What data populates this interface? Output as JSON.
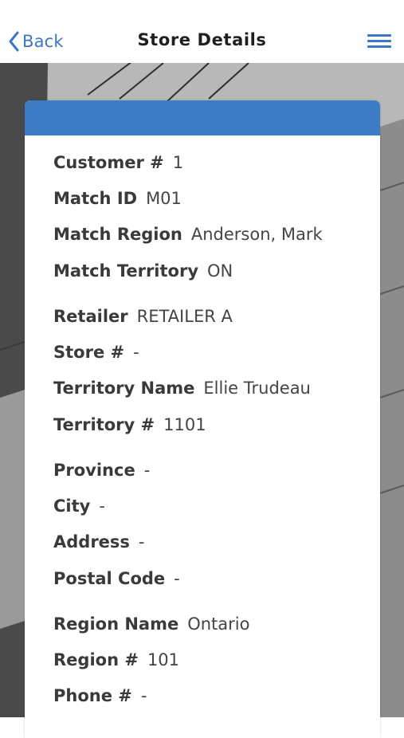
{
  "nav": {
    "back_label": "Back",
    "title": "Store Details",
    "accent_color": "#3a78c4"
  },
  "icons": {
    "back": "chevron-left-icon",
    "menu": "hamburger-menu-icon"
  },
  "card": {
    "header_color": "#3d7bc5",
    "fields": [
      {
        "label": "Customer #",
        "value": "1"
      },
      {
        "label": "Match ID",
        "value": "M01"
      },
      {
        "label": "Match Region",
        "value": "Anderson, Mark"
      },
      {
        "label": "Match Territory",
        "value": "ON"
      },
      {
        "label": "Retailer",
        "value": "RETAILER A"
      },
      {
        "label": "Store #",
        "value": "-"
      },
      {
        "label": "Territory Name",
        "value": "Ellie Trudeau"
      },
      {
        "label": "Territory #",
        "value": "1101"
      },
      {
        "label": "Province",
        "value": "-"
      },
      {
        "label": "City",
        "value": "-"
      },
      {
        "label": "Address",
        "value": "-"
      },
      {
        "label": "Postal Code",
        "value": "-"
      },
      {
        "label": "Region Name",
        "value": "Ontario"
      },
      {
        "label": "Region #",
        "value": "101"
      },
      {
        "label": "Phone #",
        "value": "-"
      }
    ]
  }
}
